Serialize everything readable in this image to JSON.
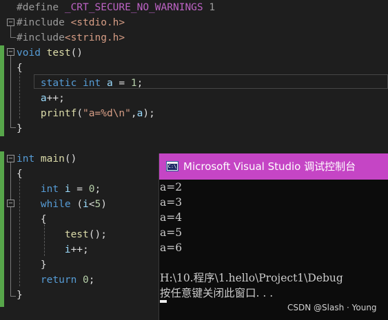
{
  "editor": {
    "lines": [
      [
        {
          "t": "#define ",
          "c": "pp"
        },
        {
          "t": "_CRT_SECURE_NO_WARNINGS",
          "c": "macro"
        },
        {
          "t": " 1",
          "c": "pp"
        }
      ],
      [
        {
          "t": "#include ",
          "c": "pp"
        },
        {
          "t": "<stdio.h>",
          "c": "str"
        }
      ],
      [
        {
          "t": "#include",
          "c": "pp"
        },
        {
          "t": "<string.h>",
          "c": "str"
        }
      ],
      [
        {
          "t": "void ",
          "c": "kw"
        },
        {
          "t": "test",
          "c": "fn"
        },
        {
          "t": "()",
          "c": "plain"
        }
      ],
      [
        {
          "t": "{",
          "c": "plain"
        }
      ],
      [
        {
          "t": "    static ",
          "c": "kw"
        },
        {
          "t": "int ",
          "c": "kw"
        },
        {
          "t": "a",
          "c": "var"
        },
        {
          "t": " = ",
          "c": "plain"
        },
        {
          "t": "1",
          "c": "num"
        },
        {
          "t": ";",
          "c": "plain"
        }
      ],
      [
        {
          "t": "    a",
          "c": "var"
        },
        {
          "t": "++;",
          "c": "plain"
        }
      ],
      [
        {
          "t": "    printf",
          "c": "fn"
        },
        {
          "t": "(",
          "c": "plain"
        },
        {
          "t": "\"a=%d\\n\"",
          "c": "str"
        },
        {
          "t": ",",
          "c": "plain"
        },
        {
          "t": "a",
          "c": "var"
        },
        {
          "t": ");",
          "c": "plain"
        }
      ],
      [
        {
          "t": "}",
          "c": "plain"
        }
      ],
      [],
      [
        {
          "t": "int ",
          "c": "kw"
        },
        {
          "t": "main",
          "c": "fn"
        },
        {
          "t": "()",
          "c": "plain"
        }
      ],
      [
        {
          "t": "{",
          "c": "plain"
        }
      ],
      [
        {
          "t": "    int ",
          "c": "kw"
        },
        {
          "t": "i",
          "c": "var"
        },
        {
          "t": " = ",
          "c": "plain"
        },
        {
          "t": "0",
          "c": "num"
        },
        {
          "t": ";",
          "c": "plain"
        }
      ],
      [
        {
          "t": "    while ",
          "c": "kw"
        },
        {
          "t": "(",
          "c": "plain"
        },
        {
          "t": "i",
          "c": "var"
        },
        {
          "t": "<",
          "c": "plain"
        },
        {
          "t": "5",
          "c": "num"
        },
        {
          "t": ")",
          "c": "plain"
        }
      ],
      [
        {
          "t": "    {",
          "c": "plain"
        }
      ],
      [
        {
          "t": "        test",
          "c": "fn"
        },
        {
          "t": "();",
          "c": "plain"
        }
      ],
      [
        {
          "t": "        i",
          "c": "var"
        },
        {
          "t": "++;",
          "c": "plain"
        }
      ],
      [
        {
          "t": "    }",
          "c": "plain"
        }
      ],
      [
        {
          "t": "    return ",
          "c": "kw"
        },
        {
          "t": "0",
          "c": "num"
        },
        {
          "t": ";",
          "c": "plain"
        }
      ],
      [
        {
          "t": "}",
          "c": "plain"
        }
      ]
    ]
  },
  "console": {
    "title": "Microsoft Visual Studio 调试控制台",
    "icon_label": "C:\\",
    "output": [
      "a=2",
      "a=3",
      "a=4",
      "a=5",
      "a=6",
      "",
      "H:\\10.程序\\1.hello\\Project1\\Debug",
      "按任意键关闭此窗口. . ."
    ],
    "title_bar_color": "#c545c5",
    "background_color": "#0c0c0c"
  },
  "watermark": "CSDN @Slash · Young",
  "colors": {
    "keyword": "#569cd6",
    "string": "#d69d85",
    "function": "#dcdcaa",
    "number": "#b5cea8",
    "variable": "#9cdcfe",
    "preprocessor": "#9b9b9b",
    "macro": "#bd63c5",
    "change_bar": "#57a64a"
  }
}
